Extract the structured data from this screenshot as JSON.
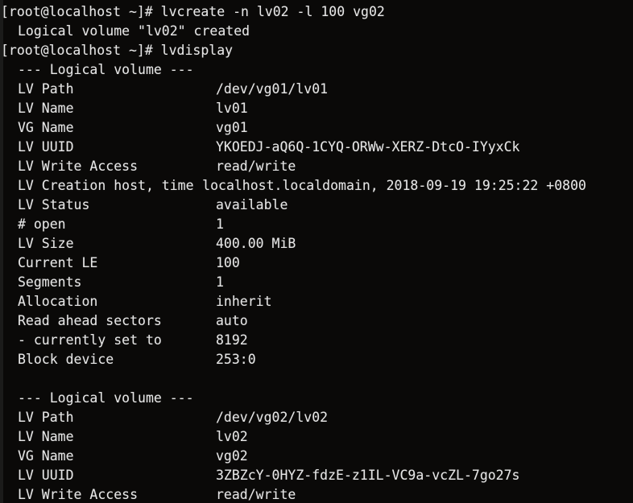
{
  "terminal": {
    "background_color": "#0a0908",
    "foreground_color": "#e6e6e6",
    "columns": 74,
    "rows": 26
  },
  "prompt": {
    "text": "[root@localhost ~]#",
    "user": "root",
    "host": "localhost",
    "cwd": "~",
    "symbol": "#"
  },
  "commands": {
    "lvcreate": "lvcreate -n lv02 -l 100 vg02",
    "lvdisplay": "lvdisplay"
  },
  "messages": {
    "created": "Logical volume \"lv02\" created"
  },
  "section_header": "--- Logical volume ---",
  "lines": [
    {
      "kind": "prompt",
      "text": "[root@localhost ~]# lvcreate -n lv02 -l 100 vg02"
    },
    {
      "kind": "out",
      "text": "Logical volume \"lv02\" created"
    },
    {
      "kind": "prompt",
      "text": "[root@localhost ~]# lvdisplay"
    },
    {
      "kind": "out",
      "text": "--- Logical volume ---"
    },
    {
      "kind": "pair",
      "label": "LV Path",
      "value": "/dev/vg01/lv01"
    },
    {
      "kind": "pair",
      "label": "LV Name",
      "value": "lv01"
    },
    {
      "kind": "pair",
      "label": "VG Name",
      "value": "vg01"
    },
    {
      "kind": "pair",
      "label": "LV UUID",
      "value": "YKOEDJ-aQ6Q-1CYQ-ORWw-XERZ-DtcO-IYyxCk"
    },
    {
      "kind": "pair",
      "label": "LV Write Access",
      "value": "read/write"
    },
    {
      "kind": "wide",
      "label": "LV Creation host, time",
      "value": "localhost.localdomain, 2018-09-19 19:25:22 +0800"
    },
    {
      "kind": "pair",
      "label": "LV Status",
      "value": "available"
    },
    {
      "kind": "pair",
      "label": "# open",
      "value": "1"
    },
    {
      "kind": "pair",
      "label": "LV Size",
      "value": "400.00 MiB"
    },
    {
      "kind": "pair",
      "label": "Current LE",
      "value": "100"
    },
    {
      "kind": "pair",
      "label": "Segments",
      "value": "1"
    },
    {
      "kind": "pair",
      "label": "Allocation",
      "value": "inherit"
    },
    {
      "kind": "pair",
      "label": "Read ahead sectors",
      "value": "auto"
    },
    {
      "kind": "pair",
      "label": "- currently set to",
      "value": "8192"
    },
    {
      "kind": "pair",
      "label": "Block device",
      "value": "253:0"
    },
    {
      "kind": "blank",
      "text": ""
    },
    {
      "kind": "out",
      "text": "--- Logical volume ---"
    },
    {
      "kind": "pair",
      "label": "LV Path",
      "value": "/dev/vg02/lv02"
    },
    {
      "kind": "pair",
      "label": "LV Name",
      "value": "lv02"
    },
    {
      "kind": "pair",
      "label": "VG Name",
      "value": "vg02"
    },
    {
      "kind": "pair",
      "label": "LV UUID",
      "value": "3ZBZcY-0HYZ-fdzE-z1IL-VC9a-vcZL-7go27s"
    },
    {
      "kind": "pair",
      "label": "LV Write Access",
      "value": "read/write"
    }
  ],
  "volumes": [
    {
      "lv_path": "/dev/vg01/lv01",
      "lv_name": "lv01",
      "vg_name": "vg01",
      "lv_uuid": "YKOEDJ-aQ6Q-1CYQ-ORWw-XERZ-DtcO-IYyxCk",
      "lv_write_access": "read/write",
      "lv_creation_host_time": "localhost.localdomain, 2018-09-19 19:25:22 +0800",
      "lv_status": "available",
      "open_count": "1",
      "lv_size": "400.00 MiB",
      "current_le": "100",
      "segments": "1",
      "allocation": "inherit",
      "read_ahead_sectors": "auto",
      "currently_set_to": "8192",
      "block_device": "253:0"
    },
    {
      "lv_path": "/dev/vg02/lv02",
      "lv_name": "lv02",
      "vg_name": "vg02",
      "lv_uuid": "3ZBZcY-0HYZ-fdzE-z1IL-VC9a-vcZL-7go27s",
      "lv_write_access": "read/write"
    }
  ]
}
